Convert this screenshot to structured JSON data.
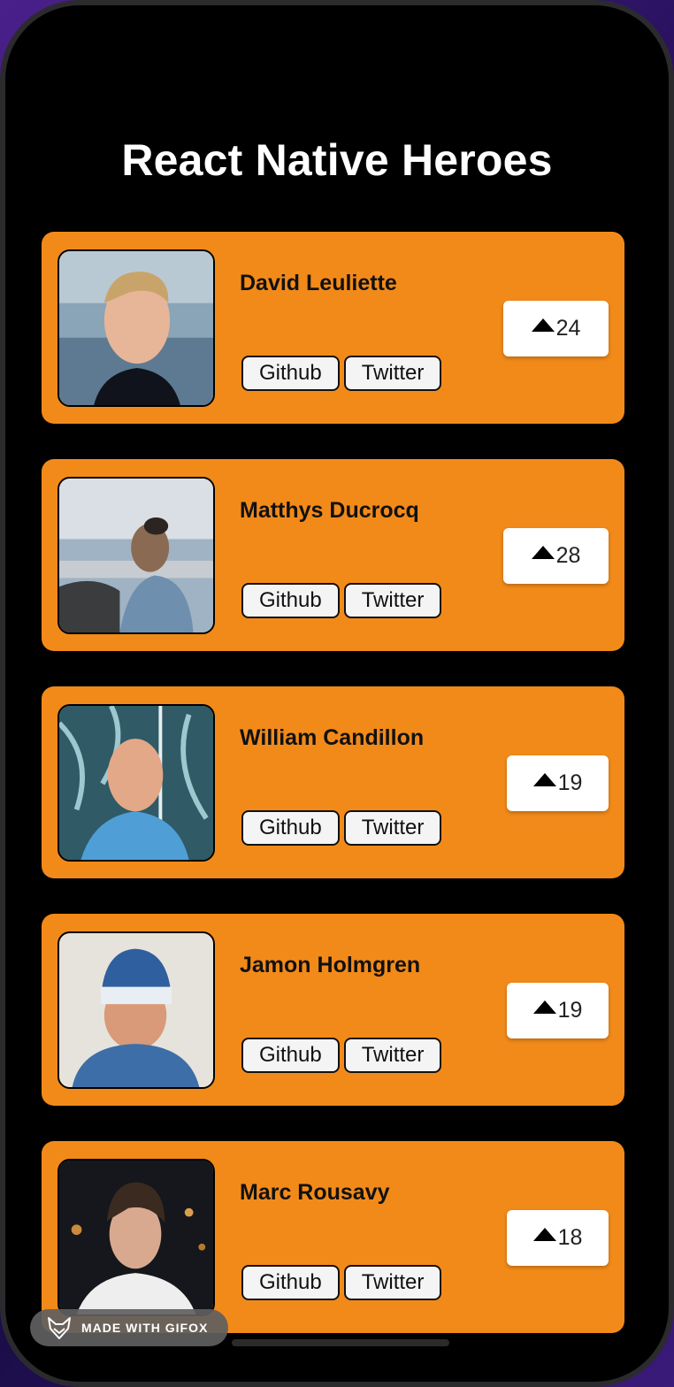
{
  "title": "React Native Heroes",
  "colors": {
    "card": "#f28a1a",
    "background": "#000000",
    "link_bg": "#f4f4f4"
  },
  "heroes": [
    {
      "name": "David Leuliette",
      "votes": "24",
      "photo": "man-with-headphones-photo"
    },
    {
      "name": "Matthys Ducrocq",
      "votes": "28",
      "photo": "man-profile-coast-photo"
    },
    {
      "name": "William Candillon",
      "votes": "19",
      "photo": "bald-man-smiling-photo"
    },
    {
      "name": "Jamon Holmgren",
      "votes": "19",
      "photo": "man-in-beanie-photo"
    },
    {
      "name": "Marc Rousavy",
      "votes": "18",
      "photo": "man-night-city-photo"
    }
  ],
  "link_labels": {
    "github": "Github",
    "twitter": "Twitter"
  },
  "vote_icon": "triangle-up-icon",
  "watermark": {
    "text": "MADE WITH GIFOX",
    "icon": "fox-logo-icon"
  }
}
